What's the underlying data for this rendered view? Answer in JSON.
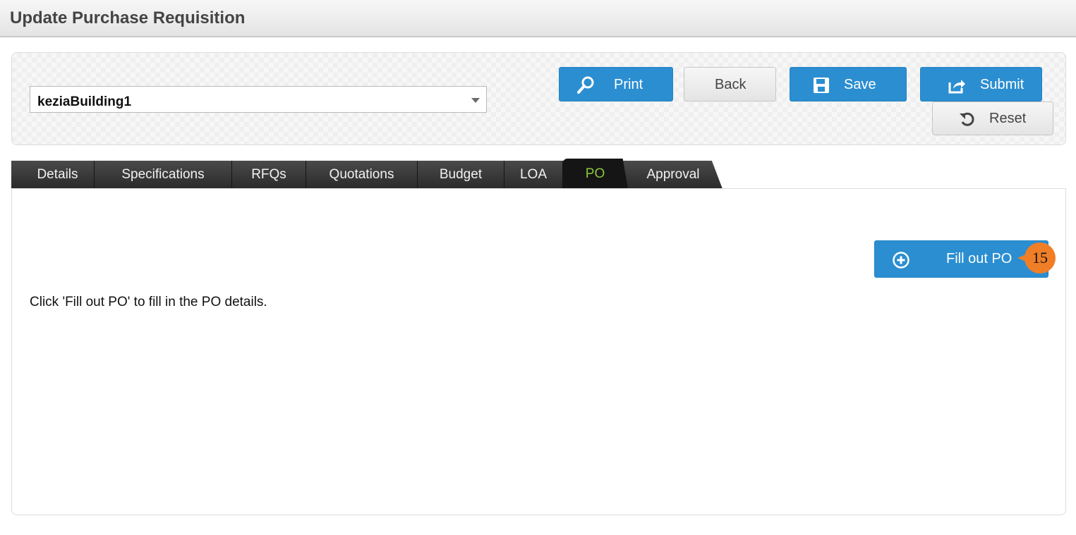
{
  "header": {
    "title": "Update Purchase Requisition"
  },
  "building_select": {
    "value": "keziaBuilding1"
  },
  "toolbar": {
    "print_label": "Print",
    "back_label": "Back",
    "save_label": "Save",
    "submit_label": "Submit",
    "reset_label": "Reset"
  },
  "tabs": [
    {
      "label": "Details"
    },
    {
      "label": "Specifications"
    },
    {
      "label": "RFQs"
    },
    {
      "label": "Quotations"
    },
    {
      "label": "Budget"
    },
    {
      "label": "LOA"
    },
    {
      "label": "PO"
    },
    {
      "label": "Approval"
    }
  ],
  "active_tab": "PO",
  "po_panel": {
    "fill_button_label": "Fill out PO",
    "instruction": "Click 'Fill out PO' to fill in the PO details."
  },
  "step_badge": {
    "number": "15"
  },
  "colors": {
    "primary_button": "#2b8ed1",
    "active_tab_text": "#8cc63f",
    "step_badge": "#f07e26"
  }
}
